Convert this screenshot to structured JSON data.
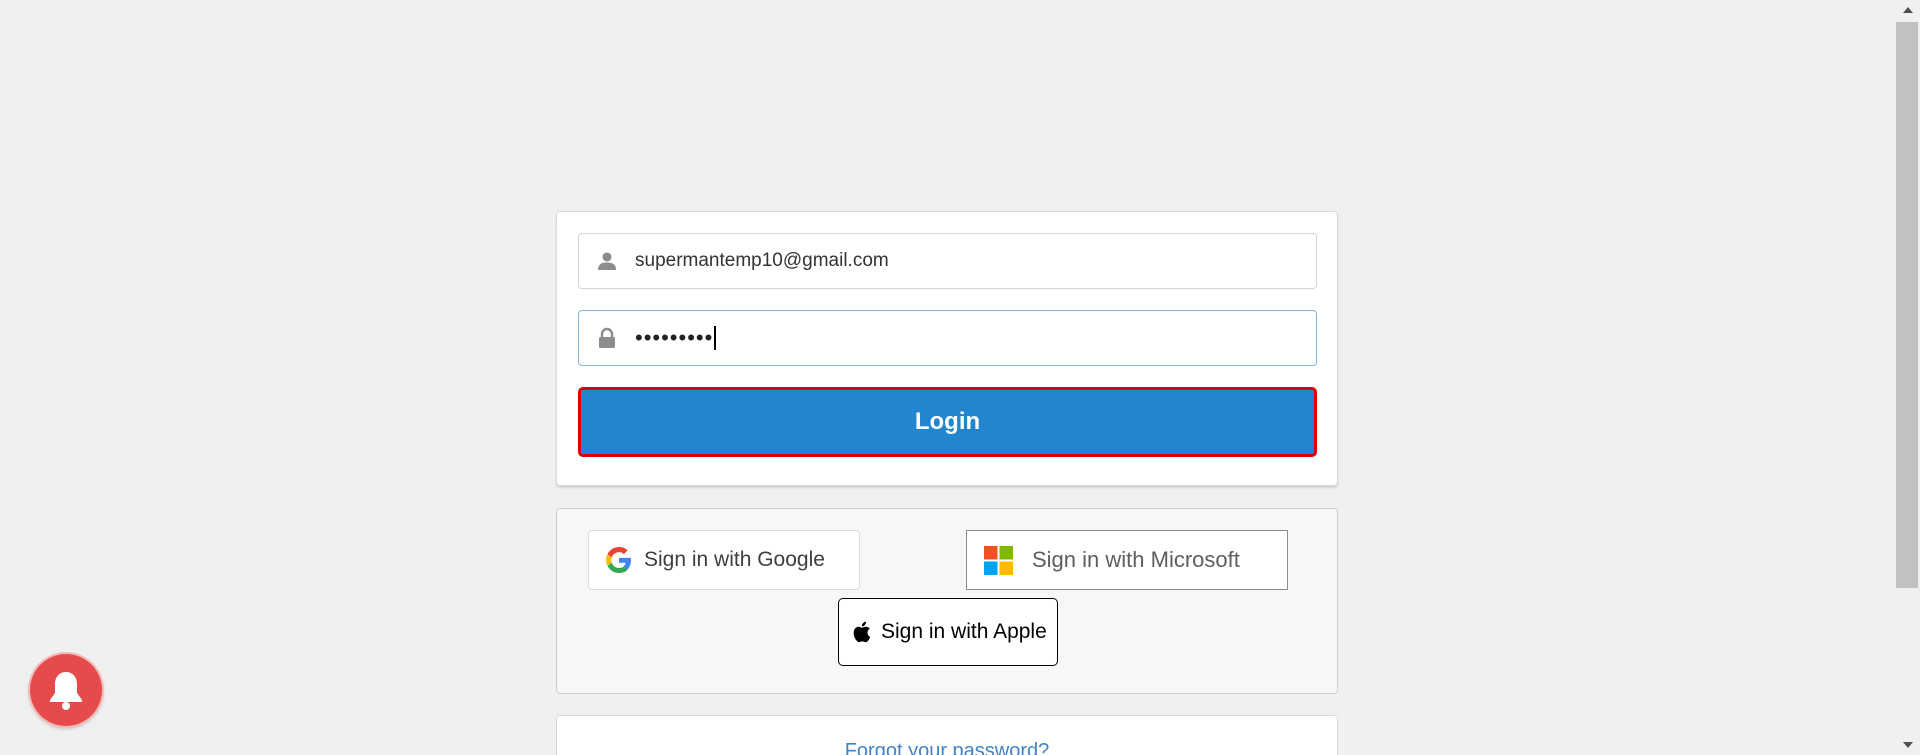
{
  "login": {
    "email_value": "supermantemp10@gmail.com",
    "password_masked": "•••••••••",
    "login_label": "Login"
  },
  "social": {
    "google_label": "Sign in with Google",
    "microsoft_label": "Sign in with Microsoft",
    "apple_label": "Sign in with Apple"
  },
  "forgot": {
    "link_label": "Forgot your password?"
  },
  "colors": {
    "background": "#f0f0f0",
    "login_button": "#2185d0",
    "login_button_border": "#e00000",
    "link": "#4183c4",
    "notification_bell": "#e54b4d"
  },
  "icons": {
    "email_field": "user-icon",
    "password_field": "lock-icon",
    "google": "google-logo-icon",
    "microsoft": "microsoft-logo-icon",
    "apple": "apple-logo-icon",
    "notification": "bell-icon"
  }
}
